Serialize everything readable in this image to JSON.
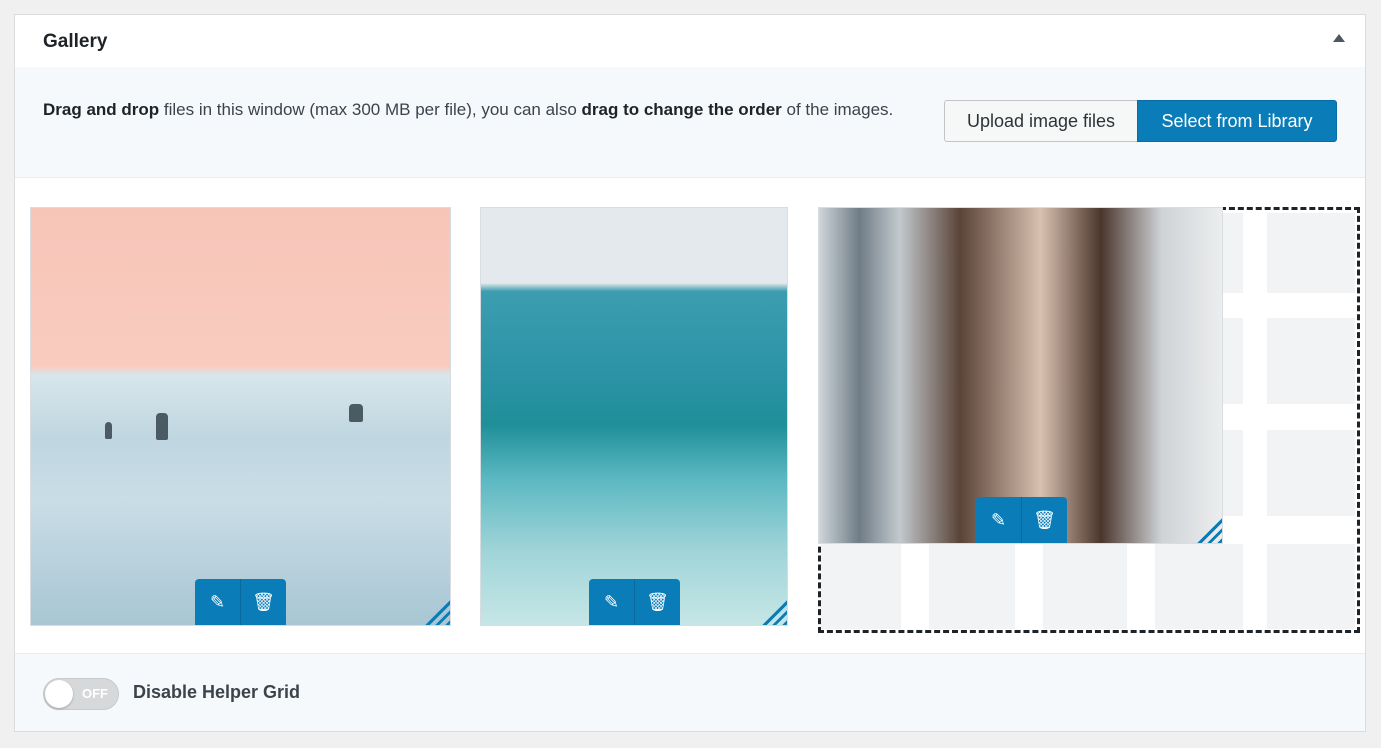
{
  "panel": {
    "title": "Gallery",
    "collapse_icon": "triangle-up-icon"
  },
  "info": {
    "text_bold_1": "Drag and drop",
    "text_1": " files in this window (max 300 MB per file), you can also ",
    "text_bold_2": "drag to change the order",
    "text_2": " of the images.",
    "upload_label": "Upload image files",
    "library_label": "Select from Library"
  },
  "gallery": {
    "items": [
      {
        "subject": "surfers in the sea",
        "edit_icon": "pencil-icon",
        "delete_icon": "trash-icon"
      },
      {
        "subject": "ocean wave",
        "edit_icon": "pencil-icon",
        "delete_icon": "trash-icon"
      },
      {
        "subject": "woman portrait",
        "edit_icon": "pencil-icon",
        "delete_icon": "trash-icon"
      }
    ],
    "colors": {
      "accent": "#0a7cb8"
    }
  },
  "footer": {
    "switch_state": "OFF",
    "switch_label": "Disable Helper Grid"
  }
}
